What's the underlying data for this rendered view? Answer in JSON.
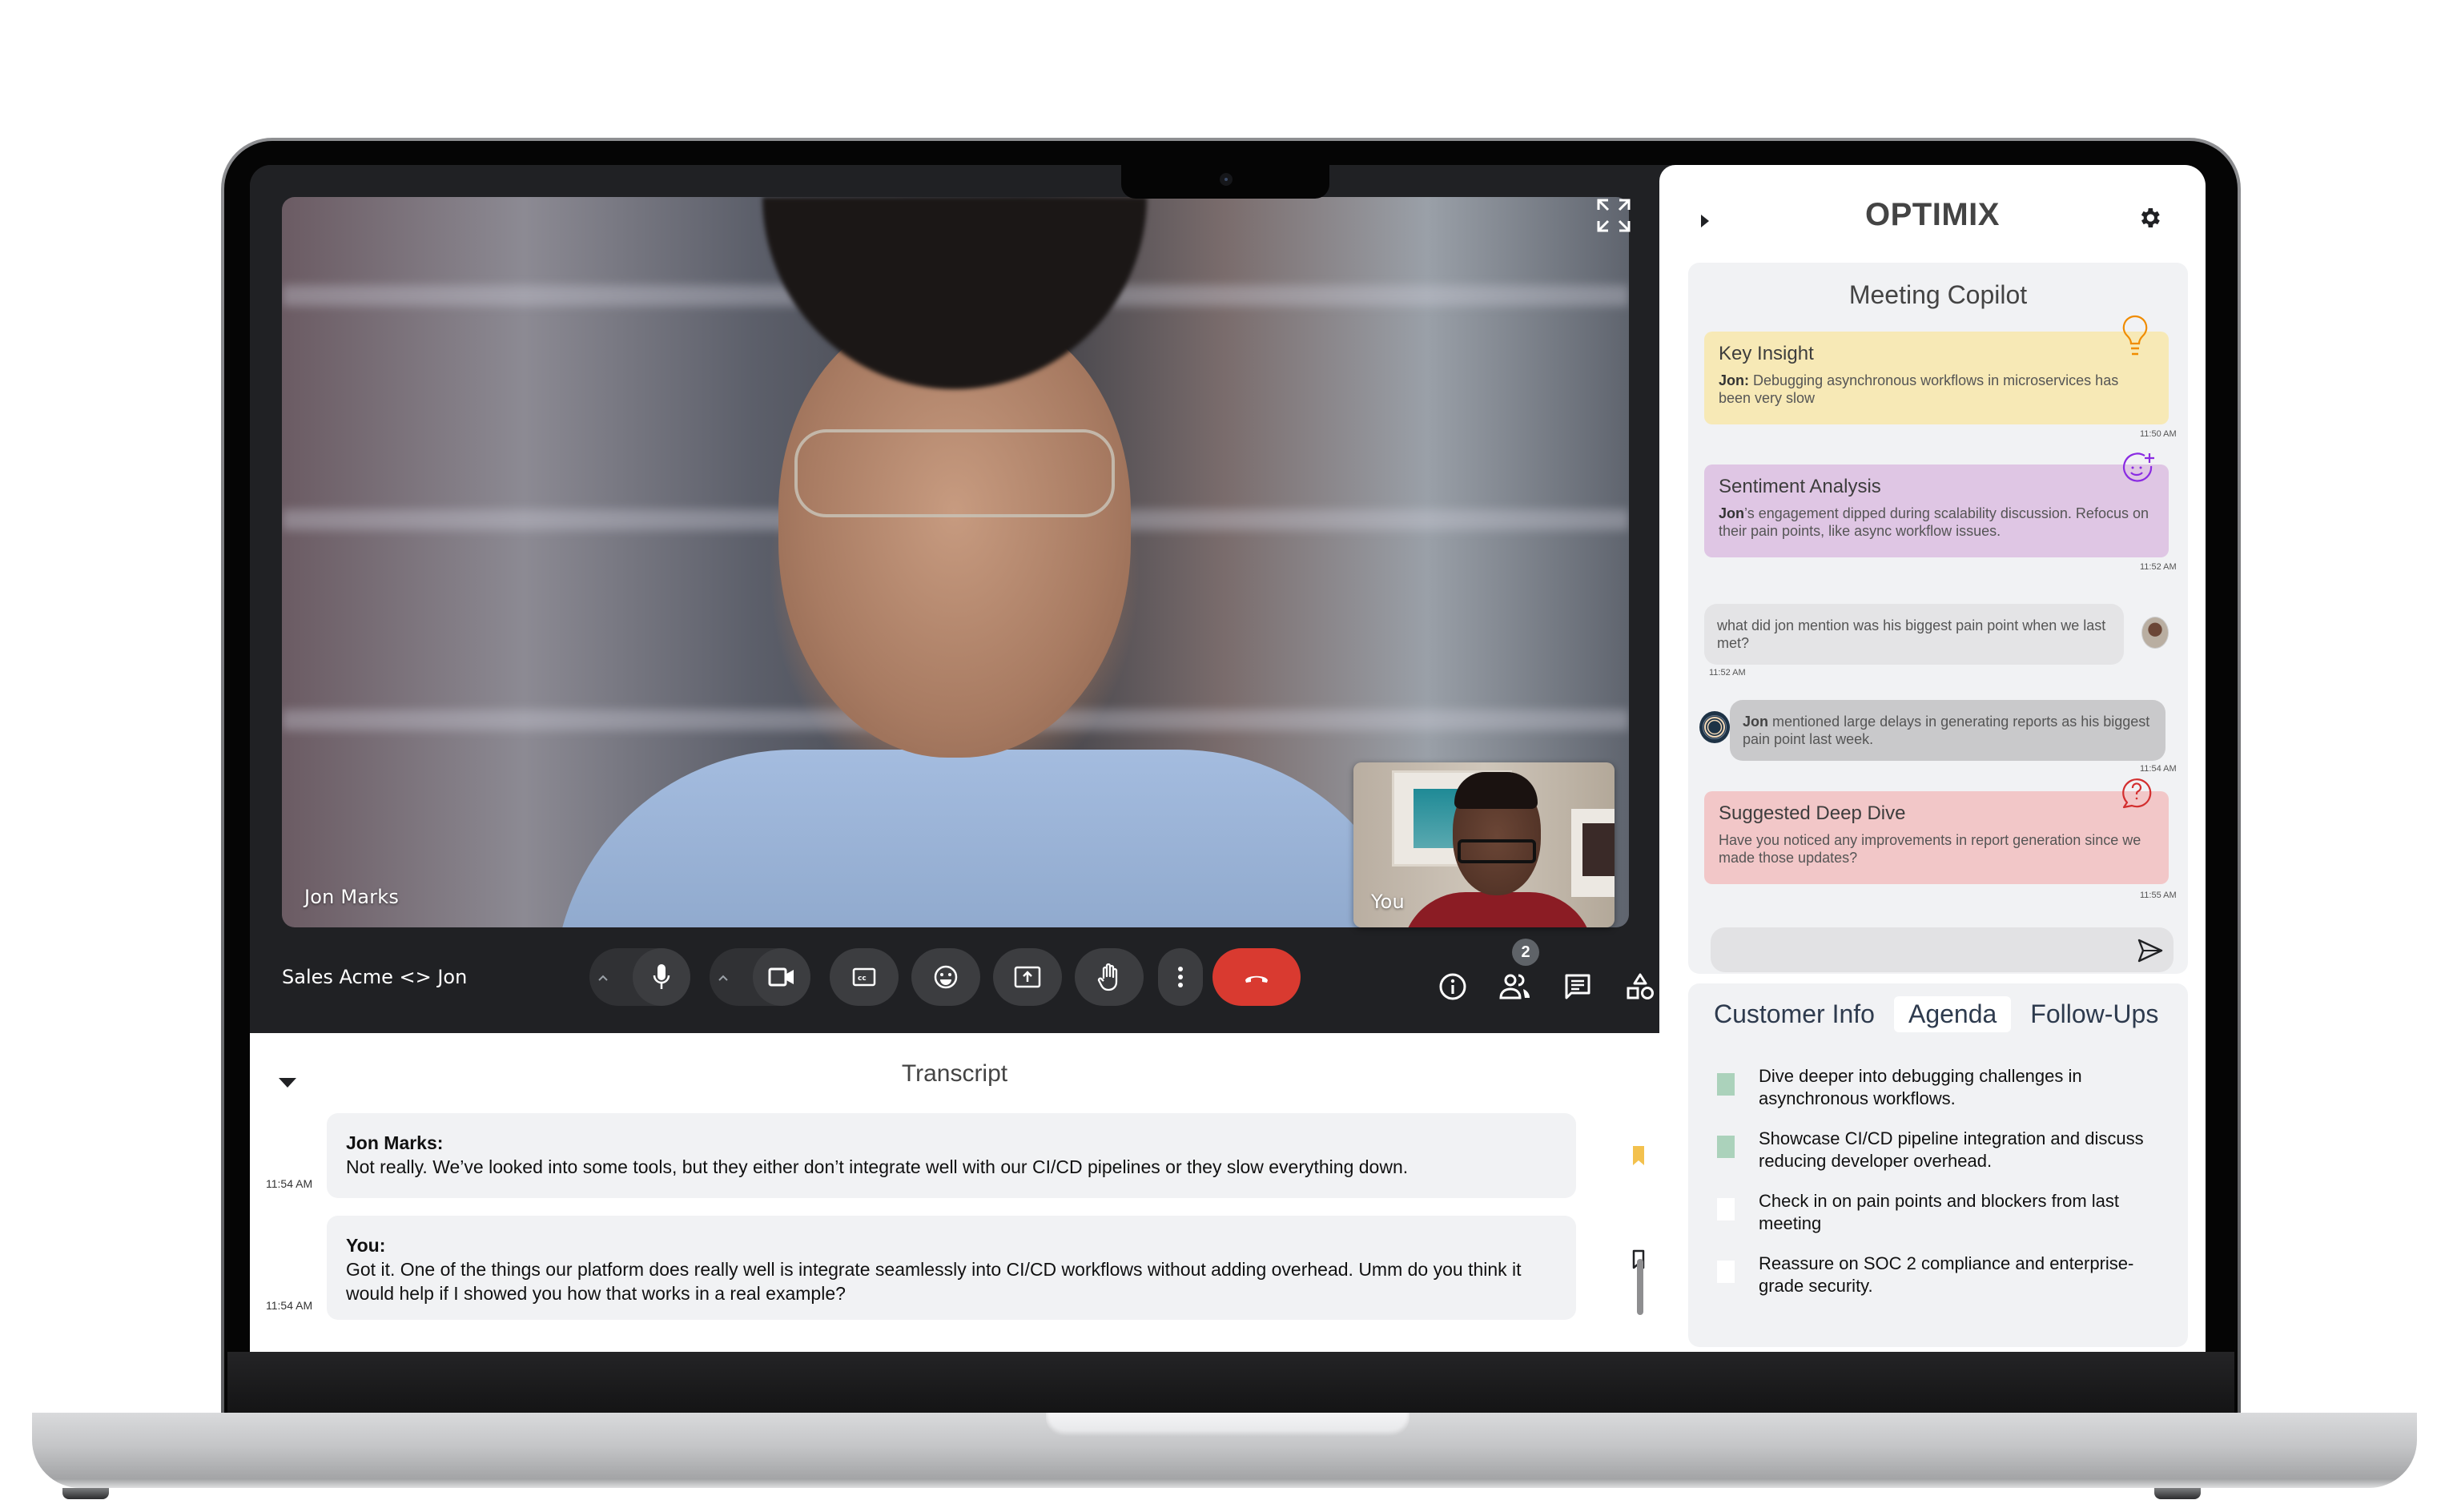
{
  "meeting": {
    "title": "Sales Acme <> Jon",
    "main_participant": "Jon Marks",
    "self_label": "You",
    "participant_count": "2",
    "colors": {
      "end_call": "#d93a30",
      "bar_bg": "#202124",
      "button_bg": "#3c3d40"
    },
    "controls": [
      {
        "name": "mic-options",
        "icon": "chevron-up-icon"
      },
      {
        "name": "microphone",
        "icon": "microphone-icon"
      },
      {
        "name": "camera-options",
        "icon": "chevron-up-icon"
      },
      {
        "name": "camera",
        "icon": "video-camera-icon"
      },
      {
        "name": "captions",
        "icon": "closed-captions-icon"
      },
      {
        "name": "reactions",
        "icon": "emoji-icon"
      },
      {
        "name": "present",
        "icon": "present-screen-icon"
      },
      {
        "name": "raise-hand",
        "icon": "hand-icon"
      },
      {
        "name": "more-options",
        "icon": "more-vertical-icon"
      },
      {
        "name": "end-call",
        "icon": "phone-hangup-icon"
      }
    ],
    "right_controls": [
      {
        "name": "meeting-details",
        "icon": "info-icon"
      },
      {
        "name": "people",
        "icon": "people-icon"
      },
      {
        "name": "chat",
        "icon": "chat-icon"
      },
      {
        "name": "activities",
        "icon": "shapes-icon"
      }
    ]
  },
  "transcript": {
    "title": "Transcript",
    "entries": [
      {
        "speaker": "Jon Marks:",
        "text": "Not really. We’ve looked into some tools, but they either don’t integrate well with our CI/CD pipelines or they slow everything down.",
        "time": "11:54 AM",
        "bookmarked": true
      },
      {
        "speaker": "You:",
        "text": "Got it. One of the things our platform does really well is integrate seamlessly into CI/CD workflows without adding overhead. Umm do you think it would help if I showed you how that works in a real example?",
        "time": "11:54 AM",
        "bookmarked": false
      }
    ]
  },
  "optimix": {
    "brand": "OPTIMIX",
    "copilot": {
      "title": "Meeting Copilot",
      "cards": [
        {
          "type": "key-insight",
          "title": "Key Insight",
          "speaker": "Jon:",
          "body": " Debugging asynchronous workflows in microservices has been very slow",
          "time": "11:50 AM",
          "color": "#f7e9b6",
          "icon_color": "#f08c00"
        },
        {
          "type": "sentiment-analysis",
          "title": "Sentiment Analysis",
          "speaker": "Jon",
          "body": "’s engagement dipped during scalability discussion. Refocus on their pain points, like async workflow issues.",
          "time": "11:52 AM",
          "color": "#dfc6e4",
          "icon_color": "#8a2be2"
        },
        {
          "type": "suggested-deep-dive",
          "title": "Suggested Deep Dive",
          "body": "Have you noticed any improvements in report generation since we made those updates?",
          "time": "11:55 AM",
          "color": "#f2c7c8",
          "icon_color": "#d32f2f"
        }
      ],
      "user_question": {
        "text": "what did jon mention was his biggest pain point when we last met?",
        "time": "11:52 AM"
      },
      "bot_answer": {
        "speaker": "Jon",
        "text": " mentioned large delays in generating reports as his biggest pain point last week.",
        "time": "11:54 AM"
      },
      "input": {
        "value": "",
        "placeholder": ""
      }
    },
    "tabs": [
      {
        "label": "Customer Info",
        "active": false
      },
      {
        "label": "Agenda",
        "active": true
      },
      {
        "label": "Follow-Ups",
        "active": false
      }
    ],
    "agenda": [
      {
        "text": "Dive deeper into debugging challenges in asynchronous workflows.",
        "done": true
      },
      {
        "text": "Showcase CI/CD pipeline integration and discuss reducing developer overhead.",
        "done": true
      },
      {
        "text": "Check in on pain points and blockers from last meeting",
        "done": false
      },
      {
        "text": "Reassure on SOC 2 compliance and enterprise-grade security.",
        "done": false
      }
    ],
    "colors": {
      "checked": "#abd2bb",
      "panel_bg": "#f1f2f4"
    }
  }
}
